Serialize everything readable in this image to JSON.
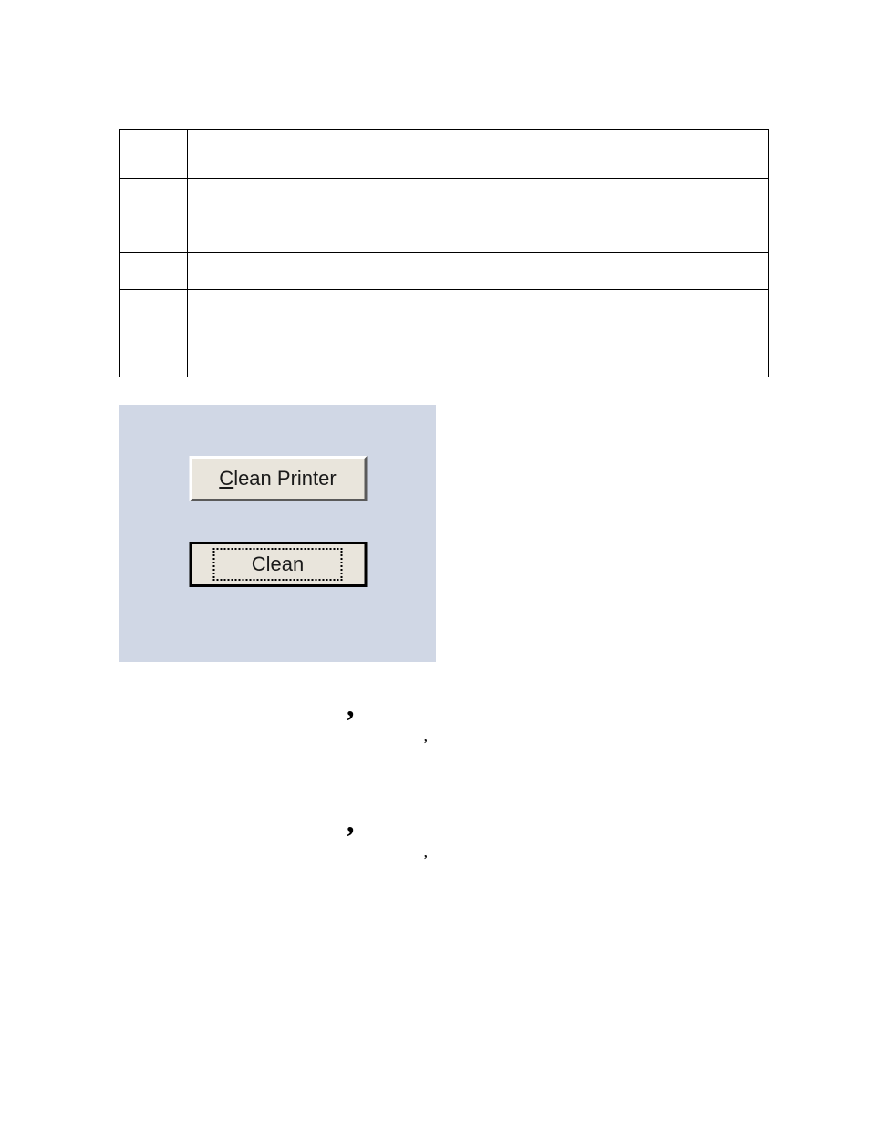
{
  "table": {
    "rows": [
      {
        "left": "",
        "right": ""
      },
      {
        "left": "",
        "right": ""
      },
      {
        "left": "",
        "right": ""
      },
      {
        "left": "",
        "right": ""
      }
    ]
  },
  "panel": {
    "button_clean_printer": "Clean Printer",
    "button_clean": "Clean"
  }
}
